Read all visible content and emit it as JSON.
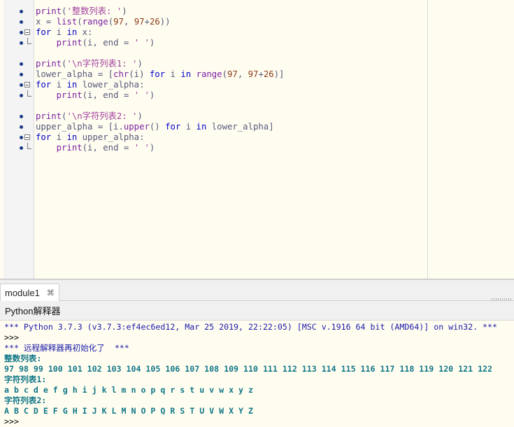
{
  "editor": {
    "lines": [
      {
        "tokens": [
          {
            "t": "print",
            "c": "fn"
          },
          {
            "t": "(",
            "c": "pn"
          },
          {
            "t": "'整数列表: '",
            "c": "str"
          },
          {
            "t": ")",
            "c": "pn"
          }
        ],
        "marker": "bullet"
      },
      {
        "tokens": [
          {
            "t": "x",
            "c": "pn"
          },
          {
            "t": " = ",
            "c": "pn"
          },
          {
            "t": "list",
            "c": "fn"
          },
          {
            "t": "(",
            "c": "pn"
          },
          {
            "t": "range",
            "c": "fn"
          },
          {
            "t": "(",
            "c": "pn"
          },
          {
            "t": "97",
            "c": "num"
          },
          {
            "t": ", ",
            "c": "pn"
          },
          {
            "t": "97",
            "c": "num"
          },
          {
            "t": "+",
            "c": "pn"
          },
          {
            "t": "26",
            "c": "num"
          },
          {
            "t": "))",
            "c": "pn"
          }
        ],
        "marker": "bullet"
      },
      {
        "tokens": [
          {
            "t": "for",
            "c": "kw"
          },
          {
            "t": " i ",
            "c": "pn"
          },
          {
            "t": "in",
            "c": "kw"
          },
          {
            "t": " x:",
            "c": "pn"
          }
        ],
        "marker": "bullet",
        "fold": "box"
      },
      {
        "tokens": [
          {
            "t": "    ",
            "c": "pn"
          },
          {
            "t": "print",
            "c": "fn"
          },
          {
            "t": "(i, end = ",
            "c": "pn"
          },
          {
            "t": "' '",
            "c": "str"
          },
          {
            "t": ")",
            "c": "pn"
          }
        ],
        "marker": "bullet",
        "fold": "end"
      },
      {
        "tokens": [],
        "marker": ""
      },
      {
        "tokens": [
          {
            "t": "print",
            "c": "fn"
          },
          {
            "t": "(",
            "c": "pn"
          },
          {
            "t": "'\\n字符列表1: '",
            "c": "str"
          },
          {
            "t": ")",
            "c": "pn"
          }
        ],
        "marker": "bullet"
      },
      {
        "tokens": [
          {
            "t": "lower_alpha = [",
            "c": "pn"
          },
          {
            "t": "chr",
            "c": "fn"
          },
          {
            "t": "(i) ",
            "c": "pn"
          },
          {
            "t": "for",
            "c": "kw"
          },
          {
            "t": " i ",
            "c": "pn"
          },
          {
            "t": "in",
            "c": "kw"
          },
          {
            "t": " ",
            "c": "pn"
          },
          {
            "t": "range",
            "c": "fn"
          },
          {
            "t": "(",
            "c": "pn"
          },
          {
            "t": "97",
            "c": "num"
          },
          {
            "t": ", ",
            "c": "pn"
          },
          {
            "t": "97",
            "c": "num"
          },
          {
            "t": "+",
            "c": "pn"
          },
          {
            "t": "26",
            "c": "num"
          },
          {
            "t": ")]",
            "c": "pn"
          }
        ],
        "marker": "bullet"
      },
      {
        "tokens": [
          {
            "t": "for",
            "c": "kw"
          },
          {
            "t": " i ",
            "c": "pn"
          },
          {
            "t": "in",
            "c": "kw"
          },
          {
            "t": " lower_alpha:",
            "c": "pn"
          }
        ],
        "marker": "bullet",
        "fold": "box"
      },
      {
        "tokens": [
          {
            "t": "    ",
            "c": "pn"
          },
          {
            "t": "print",
            "c": "fn"
          },
          {
            "t": "(i, end = ",
            "c": "pn"
          },
          {
            "t": "' '",
            "c": "str"
          },
          {
            "t": ")",
            "c": "pn"
          }
        ],
        "marker": "bullet",
        "fold": "end"
      },
      {
        "tokens": [],
        "marker": ""
      },
      {
        "tokens": [
          {
            "t": "print",
            "c": "fn"
          },
          {
            "t": "(",
            "c": "pn"
          },
          {
            "t": "'\\n字符列表2: '",
            "c": "str"
          },
          {
            "t": ")",
            "c": "pn"
          }
        ],
        "marker": "bullet"
      },
      {
        "tokens": [
          {
            "t": "upper_alpha = [i.",
            "c": "pn"
          },
          {
            "t": "upper",
            "c": "fn"
          },
          {
            "t": "() ",
            "c": "pn"
          },
          {
            "t": "for",
            "c": "kw"
          },
          {
            "t": " i ",
            "c": "pn"
          },
          {
            "t": "in",
            "c": "kw"
          },
          {
            "t": " lower_alpha]",
            "c": "pn"
          }
        ],
        "marker": "bullet"
      },
      {
        "tokens": [
          {
            "t": "for",
            "c": "kw"
          },
          {
            "t": " i ",
            "c": "pn"
          },
          {
            "t": "in",
            "c": "kw"
          },
          {
            "t": " upper_alpha:",
            "c": "pn"
          }
        ],
        "marker": "bullet",
        "fold": "box"
      },
      {
        "tokens": [
          {
            "t": "    ",
            "c": "pn"
          },
          {
            "t": "print",
            "c": "fn"
          },
          {
            "t": "(i, end = ",
            "c": "pn"
          },
          {
            "t": "' '",
            "c": "str"
          },
          {
            "t": ")",
            "c": "pn"
          }
        ],
        "marker": "bullet",
        "fold": "end"
      }
    ]
  },
  "tabs": [
    {
      "label": "module1",
      "close": "⌘"
    }
  ],
  "shell": {
    "title": "Python解释器",
    "lines": [
      {
        "text": "*** Python 3.7.3 (v3.7.3:ef4ec6ed12, Mar 25 2019, 22:22:05) [MSC v.1916 64 bit (AMD64)] on win32. ***",
        "kind": "banner"
      },
      {
        "text": ">>>",
        "kind": "prompt"
      },
      {
        "text": "*** 远程解释器再初始化了  ***",
        "kind": "banner"
      },
      {
        "text": "整数列表:",
        "kind": "out"
      },
      {
        "text": "97 98 99 100 101 102 103 104 105 106 107 108 109 110 111 112 113 114 115 116 117 118 119 120 121 122",
        "kind": "out"
      },
      {
        "text": "字符列表1:",
        "kind": "out"
      },
      {
        "text": "a b c d e f g h i j k l m n o p q r s t u v w x y z",
        "kind": "out"
      },
      {
        "text": "字符列表2:",
        "kind": "out"
      },
      {
        "text": "A B C D E F G H I J K L M N O P Q R S T U V W X Y Z",
        "kind": "out"
      },
      {
        "text": ">>>",
        "kind": "prompt"
      }
    ]
  },
  "colors": {
    "editor_bg": "#fffdf0",
    "keyword": "#0000c8",
    "builtin": "#7a1fa2",
    "string": "#a2409e",
    "number": "#8a3b1a",
    "shell_banner": "#1a1aa8",
    "shell_output": "#117788"
  }
}
